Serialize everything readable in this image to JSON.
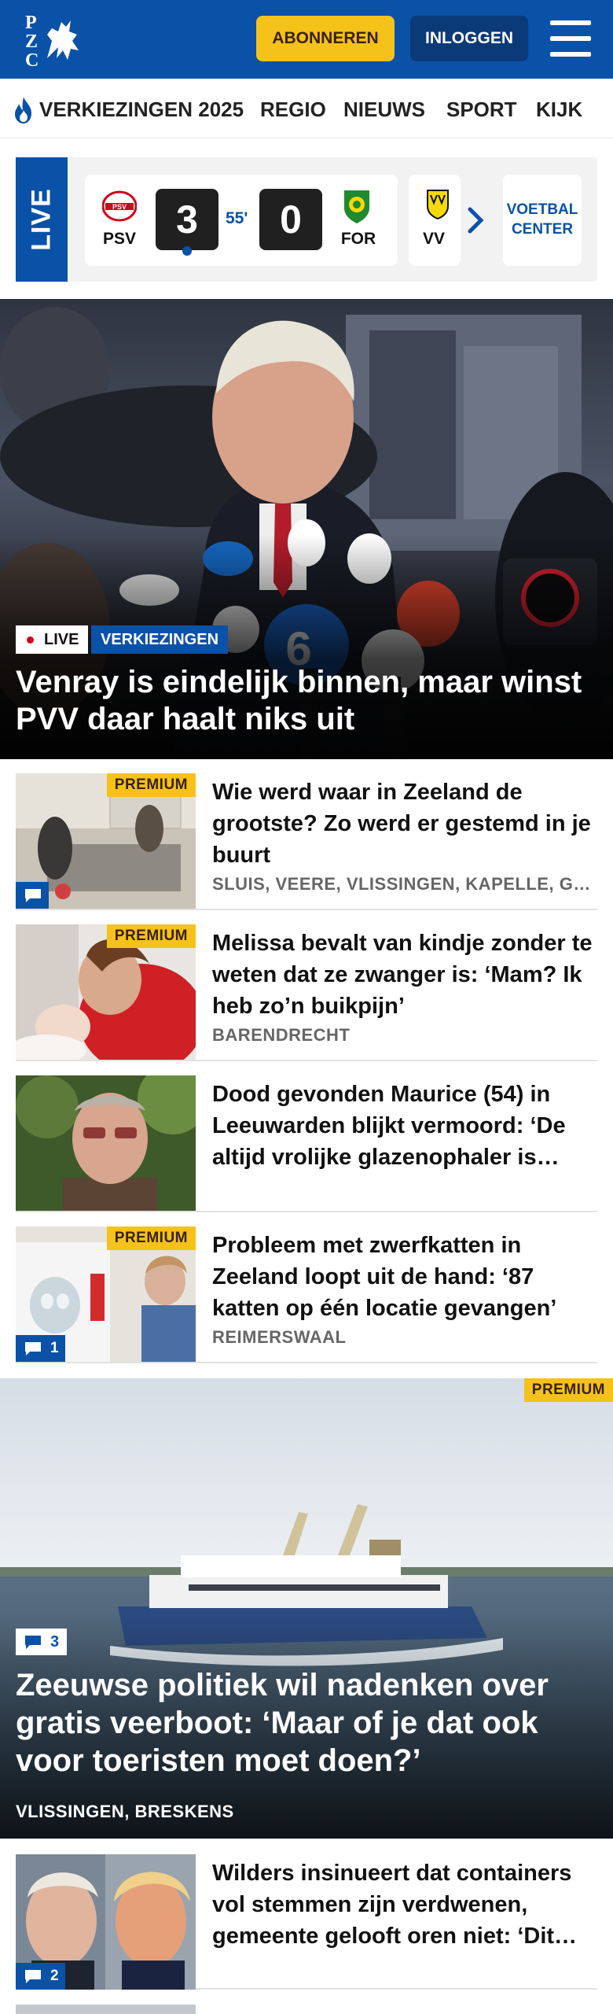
{
  "header": {
    "logo_text": "PZC",
    "subscribe_label": "ABONNEREN",
    "login_label": "INLOGGEN",
    "menu_icon": "hamburger-icon",
    "brand_color": "#0a51a8",
    "accent_color": "#f5c21a"
  },
  "nav": {
    "items": [
      {
        "label": "VERKIEZINGEN 2025",
        "icon": "flame-icon"
      },
      {
        "label": "REGIO"
      },
      {
        "label": "NIEUWS"
      },
      {
        "label": "SPORT"
      },
      {
        "label": "KIJK"
      }
    ]
  },
  "scoreboard": {
    "live_label": "LIVE",
    "match": {
      "home_team": "PSV",
      "home_score": "3",
      "minute": "55'",
      "away_score": "0",
      "away_team": "FOR"
    },
    "next_team": "VV",
    "next_icon": "chevron-right-icon",
    "center_label_line1": "VOETBAL",
    "center_label_line2": "CENTER"
  },
  "hero": {
    "live_tag": "LIVE",
    "category_tag": "VERKIEZINGEN",
    "title": "Venray is eindelijk binnen, maar winst PVV daar haalt niks uit"
  },
  "articles": [
    {
      "premium": "PREMIUM",
      "title": "Wie werd waar in Zeeland de grootste? Zo werd er gestemd in je buurt",
      "location": "SLUIS, VEERE, VLISSINGEN, KAPELLE, GOES",
      "comment_count": ""
    },
    {
      "premium": "PREMIUM",
      "title": "Melissa bevalt van kindje zonder te weten dat ze zwanger is: ‘Mam? Ik heb zo’n buikpijn’",
      "location": "BARENDRECHT",
      "comment_count": null
    },
    {
      "premium": null,
      "title": "Dood gevonden Maurice (54) in Leeuwarden blijkt vermoord: ‘De altijd vrolijke glazenophaler is…",
      "location": null,
      "comment_count": null
    },
    {
      "premium": "PREMIUM",
      "title": "Probleem met zwerfkatten in Zeeland loopt uit de hand: ‘87 katten op één locatie gevangen’",
      "location": "REIMERSWAAL",
      "comment_count": "1"
    }
  ],
  "feature": {
    "premium": "PREMIUM",
    "comment_count": "3",
    "title": "Zeeuwse politiek wil nadenken over gratis veerboot: ‘Maar of je dat ook voor toeristen moet doen?’",
    "location": "VLISSINGEN, BRESKENS"
  },
  "bottom_article": {
    "title": "Wilders insinueert dat containers vol stemmen zijn verdwenen, gemeente gelooft oren niet: ‘Dit…",
    "comment_count": "2"
  }
}
